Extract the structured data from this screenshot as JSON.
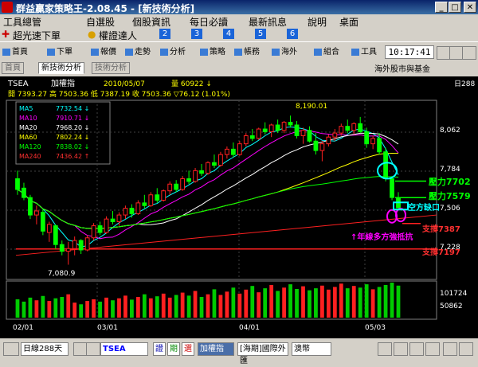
{
  "window": {
    "title": "群益贏家策略王-2.08.45 - [新技術分析]",
    "controls": [
      "_",
      "□",
      "✕"
    ]
  },
  "menu": [
    {
      "label": "工具總管"
    },
    {
      "label": "自選股"
    },
    {
      "label": "個股資訊"
    },
    {
      "label": "每日必讀"
    },
    {
      "label": "最新訊息"
    },
    {
      "label": "說明"
    },
    {
      "label": "桌面"
    }
  ],
  "bar2": {
    "items": [
      "超光速下單",
      "權證達人"
    ],
    "numbered_tabs": [
      "2",
      "3",
      "4",
      "5",
      "6"
    ]
  },
  "toolbar": {
    "buttons": [
      "首頁",
      "下單",
      "報價",
      "走勢",
      "分析",
      "策略",
      "帳務",
      "海外",
      "組合",
      "工具"
    ],
    "clock": "10:17:41"
  },
  "tabs": {
    "items": [
      "首頁",
      "新技術分析",
      "技術分析"
    ],
    "active": "新技術分析",
    "right_label": "海外股市與基金"
  },
  "chart_header": {
    "symbol": "TSEA",
    "mode": "加權指",
    "date": "2010/05/07",
    "volume_label": "量 60922 ↓",
    "ohlc_line": "開 7393.27  高 7503.36  低 7387.19  收 7503.36  ▽76.12  (1.01%)",
    "period": "日288"
  },
  "ma_legend": [
    {
      "label": "MA5",
      "value": "7732.54 ↓",
      "color": "#00ffff"
    },
    {
      "label": "MA10",
      "value": "7910.71 ↓",
      "color": "#ff00ff"
    },
    {
      "label": "MA20",
      "value": "7968.20 ↓",
      "color": "#ffffff"
    },
    {
      "label": "MA60",
      "value": "7802.24 ↓",
      "color": "#ffff00"
    },
    {
      "label": "MA120",
      "value": "7838.02 ↓",
      "color": "#00ff00"
    },
    {
      "label": "MA240",
      "value": "7436.42 ↑",
      "color": "#ff3030"
    }
  ],
  "annotations": {
    "high": "8,190.01",
    "low": "7,080.9",
    "resist1": "壓力7702",
    "resist2": "壓力7579",
    "gap": "空方缺口",
    "support1": "支撐7387",
    "support2": "支撐7197",
    "yearline": "↑年線多方強抵抗"
  },
  "y_labels": [
    "8,062",
    "7,784",
    "7,506",
    "7,228"
  ],
  "vol_labels": [
    "101724",
    "50862"
  ],
  "x_labels": [
    "02/01",
    "03/01",
    "04/01",
    "05/03"
  ],
  "bottom": {
    "period_select": "日線288天",
    "symbol": "TSEA",
    "btn1": "證",
    "btn2": "期",
    "btn3": "選",
    "mode": "加權指",
    "exchange": "[海期]國際外匯",
    "market": "澳幣"
  },
  "chart_data": {
    "type": "candlestick",
    "title": "",
    "ylim": [
      7000,
      8280
    ],
    "candles": [
      [
        7720,
        7780,
        7600,
        7640
      ],
      [
        7650,
        7690,
        7560,
        7580
      ],
      [
        7580,
        7600,
        7420,
        7450
      ],
      [
        7450,
        7520,
        7380,
        7480
      ],
      [
        7470,
        7490,
        7300,
        7330
      ],
      [
        7320,
        7400,
        7250,
        7380
      ],
      [
        7370,
        7380,
        7200,
        7230
      ],
      [
        7230,
        7260,
        7150,
        7180
      ],
      [
        7180,
        7250,
        7080,
        7200
      ],
      [
        7200,
        7290,
        7150,
        7260
      ],
      [
        7260,
        7270,
        7160,
        7190
      ],
      [
        7190,
        7300,
        7180,
        7280
      ],
      [
        7280,
        7390,
        7260,
        7370
      ],
      [
        7370,
        7400,
        7300,
        7320
      ],
      [
        7320,
        7440,
        7310,
        7420
      ],
      [
        7420,
        7480,
        7380,
        7400
      ],
      [
        7400,
        7470,
        7370,
        7450
      ],
      [
        7450,
        7520,
        7420,
        7500
      ],
      [
        7500,
        7530,
        7430,
        7460
      ],
      [
        7460,
        7560,
        7450,
        7540
      ],
      [
        7540,
        7600,
        7500,
        7520
      ],
      [
        7520,
        7620,
        7510,
        7600
      ],
      [
        7600,
        7650,
        7540,
        7560
      ],
      [
        7560,
        7640,
        7550,
        7630
      ],
      [
        7630,
        7700,
        7600,
        7680
      ],
      [
        7680,
        7710,
        7620,
        7640
      ],
      [
        7640,
        7740,
        7630,
        7720
      ],
      [
        7720,
        7780,
        7680,
        7700
      ],
      [
        7700,
        7800,
        7690,
        7780
      ],
      [
        7780,
        7830,
        7740,
        7760
      ],
      [
        7760,
        7850,
        7750,
        7840
      ],
      [
        7840,
        7900,
        7800,
        7820
      ],
      [
        7820,
        7920,
        7810,
        7900
      ],
      [
        7900,
        7960,
        7870,
        7940
      ],
      [
        7940,
        7990,
        7880,
        7900
      ],
      [
        7900,
        8000,
        7890,
        7980
      ],
      [
        7980,
        8060,
        7960,
        8040
      ],
      [
        8040,
        8090,
        8000,
        8020
      ],
      [
        8020,
        8100,
        8010,
        8090
      ],
      [
        8090,
        8140,
        8050,
        8070
      ],
      [
        8070,
        8130,
        8030,
        8120
      ],
      [
        8120,
        8160,
        8060,
        8080
      ],
      [
        8080,
        8150,
        8060,
        8140
      ],
      [
        8140,
        8190,
        8100,
        8120
      ],
      [
        8120,
        8150,
        8020,
        8040
      ],
      [
        8040,
        8100,
        7980,
        8080
      ],
      [
        8080,
        8110,
        7990,
        8000
      ],
      [
        8000,
        8060,
        7900,
        7930
      ],
      [
        7930,
        8000,
        7850,
        7980
      ],
      [
        7980,
        8050,
        7960,
        8030
      ],
      [
        8030,
        8090,
        8000,
        8060
      ],
      [
        8060,
        8130,
        8040,
        8110
      ],
      [
        8110,
        8160,
        8060,
        8080
      ],
      [
        8080,
        8140,
        8050,
        8130
      ],
      [
        8130,
        8180,
        8060,
        8070
      ],
      [
        8070,
        8100,
        7950,
        7980
      ],
      [
        7980,
        8040,
        7940,
        8020
      ],
      [
        8020,
        8060,
        7900,
        7920
      ],
      [
        7920,
        7950,
        7700,
        7720
      ],
      [
        7720,
        7740,
        7560,
        7580
      ],
      [
        7580,
        7620,
        7500,
        7503
      ]
    ],
    "volumes": [
      55,
      48,
      60,
      52,
      65,
      50,
      58,
      62,
      70,
      45,
      40,
      50,
      55,
      48,
      60,
      52,
      58,
      66,
      54,
      62,
      70,
      58,
      64,
      72,
      60,
      68,
      75,
      66,
      80,
      62,
      70,
      85,
      68,
      78,
      90,
      72,
      84,
      95,
      76,
      88,
      98,
      80,
      90,
      100,
      86,
      94,
      82,
      88,
      96,
      84,
      92,
      102,
      88,
      95,
      90,
      100,
      85,
      92,
      98,
      105,
      96
    ],
    "volume_colors": "red/green"
  }
}
